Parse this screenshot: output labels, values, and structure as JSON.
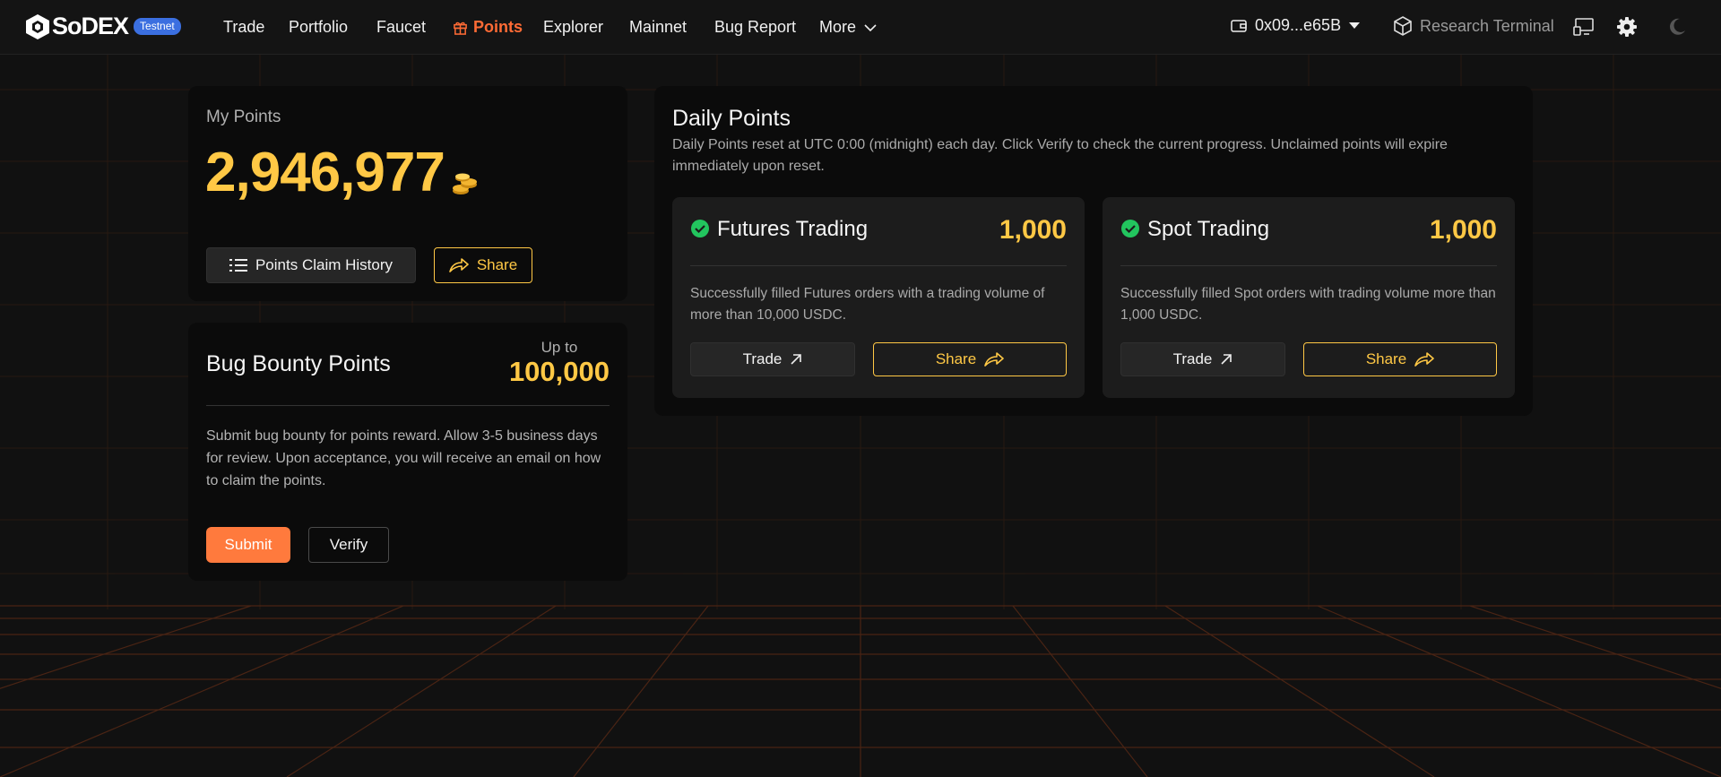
{
  "nav": {
    "logo_text": "SoDEX",
    "badge": "Testnet",
    "items": [
      {
        "label": "Trade"
      },
      {
        "label": "Portfolio"
      },
      {
        "label": "Faucet"
      },
      {
        "label": "Points"
      },
      {
        "label": "Explorer"
      },
      {
        "label": "Mainnet"
      },
      {
        "label": "Bug Report"
      },
      {
        "label": "More"
      }
    ],
    "wallet": "0x09...e65B",
    "research": "Research Terminal"
  },
  "my_points": {
    "label": "My Points",
    "value": "2,946,977",
    "history_button": "Points Claim History",
    "share_button": "Share"
  },
  "bug_bounty": {
    "title": "Bug Bounty Points",
    "up_to": "Up to",
    "amount": "100,000",
    "description": "Submit bug bounty for points reward. Allow 3-5 business days for review. Upon acceptance, you will receive an email on how to claim the points.",
    "submit": "Submit",
    "verify": "Verify"
  },
  "daily": {
    "title": "Daily Points",
    "description": "Daily Points reset at UTC 0:00 (midnight) each day. Click Verify to check the current progress. Unclaimed points will expire immediately upon reset.",
    "tasks": [
      {
        "title": "Futures Trading",
        "points": "1,000",
        "description": "Successfully filled Futures orders with a trading volume of more than 10,000 USDC.",
        "trade": "Trade",
        "share": "Share"
      },
      {
        "title": "Spot Trading",
        "points": "1,000",
        "description": "Successfully filled Spot orders with trading volume more than 1,000 USDC.",
        "trade": "Trade",
        "share": "Share"
      }
    ]
  },
  "colors": {
    "accent": "#ff6b35",
    "gold": "#ffc845",
    "success": "#22c55e",
    "badge": "#3b6fe0"
  }
}
